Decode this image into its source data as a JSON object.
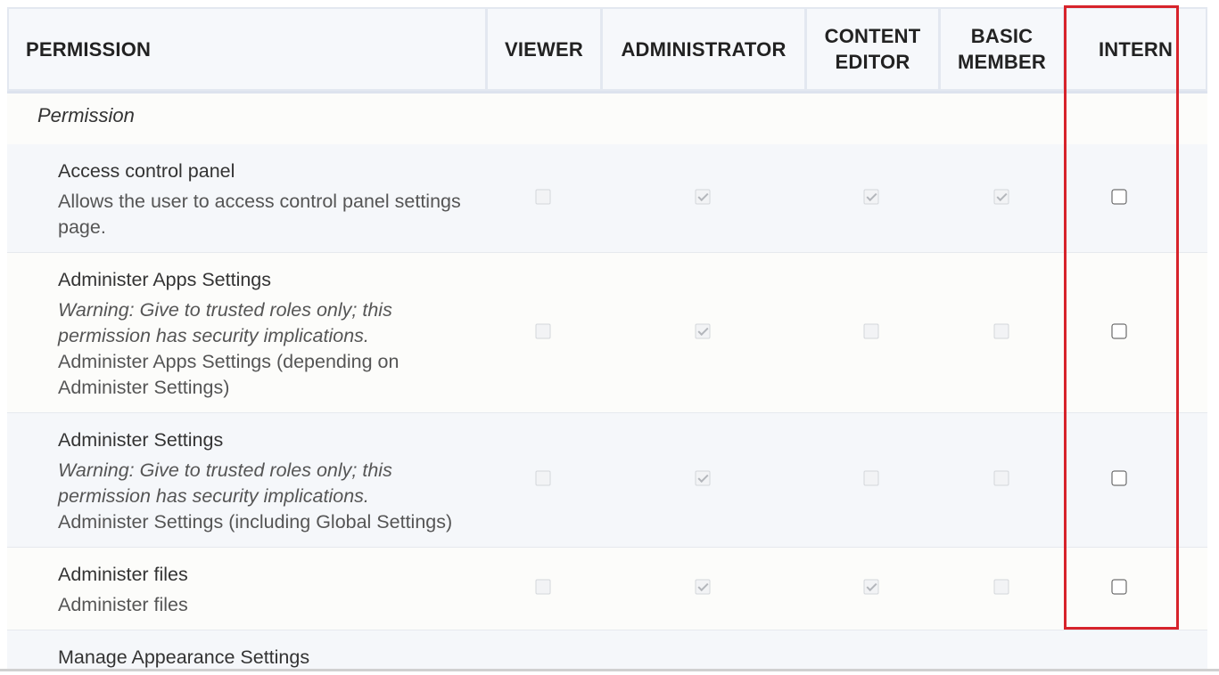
{
  "columns": [
    {
      "label": "PERMISSION"
    },
    {
      "label": "VIEWER"
    },
    {
      "label": "ADMINISTRATOR"
    },
    {
      "label": "CONTENT\nEDITOR"
    },
    {
      "label": "BASIC\nMEMBER"
    },
    {
      "label": "INTERN"
    }
  ],
  "group_label": "Permission",
  "rows": [
    {
      "title": "Access control panel",
      "warning": "",
      "description": "Allows the user to access control panel settings page.",
      "viewer": false,
      "administrator": true,
      "content_editor": true,
      "basic_member": true,
      "intern": false
    },
    {
      "title": "Administer Apps Settings",
      "warning": "Warning: Give to trusted roles only; this permission has security implications.",
      "description": "Administer Apps Settings (depending on Administer Settings)",
      "viewer": false,
      "administrator": true,
      "content_editor": false,
      "basic_member": false,
      "intern": false
    },
    {
      "title": "Administer Settings",
      "warning": "Warning: Give to trusted roles only; this permission has security implications.",
      "description": "Administer Settings (including Global Settings)",
      "viewer": false,
      "administrator": true,
      "content_editor": false,
      "basic_member": false,
      "intern": false
    },
    {
      "title": "Administer files",
      "warning": "",
      "description": "Administer files",
      "viewer": false,
      "administrator": true,
      "content_editor": true,
      "basic_member": false,
      "intern": false
    },
    {
      "title": "Manage Appearance Settings",
      "warning": "",
      "description": ""
    }
  ],
  "colors": {
    "highlight": "#d7232b"
  }
}
